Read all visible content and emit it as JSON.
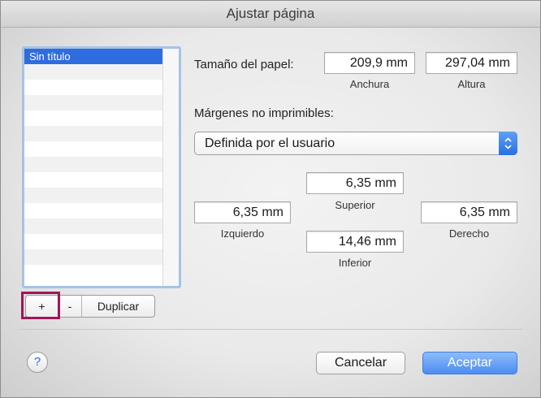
{
  "window": {
    "title": "Ajustar página"
  },
  "list": {
    "items": [
      "Sin título",
      "",
      "",
      "",
      "",
      "",
      "",
      "",
      "",
      "",
      "",
      "",
      "",
      "",
      ""
    ],
    "selected_index": 0
  },
  "list_buttons": {
    "add": "+",
    "remove": "-",
    "duplicate": "Duplicar"
  },
  "paper_size": {
    "label": "Tamaño del papel:",
    "width": {
      "value": "209,9 mm",
      "caption": "Anchura"
    },
    "height": {
      "value": "297,04 mm",
      "caption": "Altura"
    }
  },
  "margins": {
    "label": "Márgenes no imprimibles:",
    "preset": "Definida por el usuario",
    "top": {
      "value": "6,35 mm",
      "caption": "Superior"
    },
    "left": {
      "value": "6,35 mm",
      "caption": "Izquierdo"
    },
    "right": {
      "value": "6,35 mm",
      "caption": "Derecho"
    },
    "bottom": {
      "value": "14,46 mm",
      "caption": "Inferior"
    }
  },
  "footer": {
    "help": "?",
    "cancel": "Cancelar",
    "accept": "Aceptar"
  },
  "colors": {
    "accent": "#2f6ce0",
    "highlight": "#a0145a"
  }
}
